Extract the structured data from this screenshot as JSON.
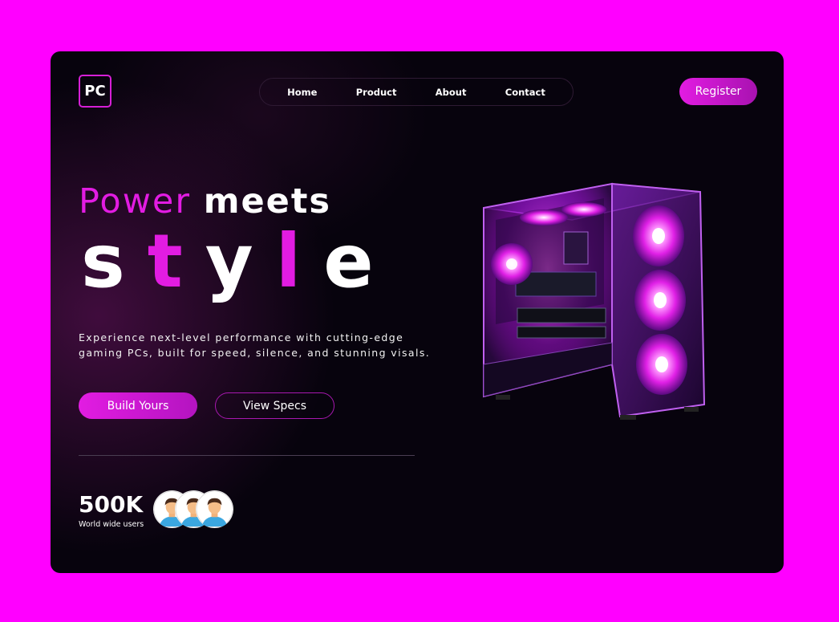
{
  "brand": {
    "logo_text": "PC"
  },
  "nav": {
    "items": [
      {
        "label": "Home"
      },
      {
        "label": "Product"
      },
      {
        "label": "About"
      },
      {
        "label": "Contact"
      }
    ]
  },
  "header": {
    "register_label": "Register"
  },
  "hero": {
    "headline_part1": "Power",
    "headline_part2": "meets",
    "headline_word_letters": [
      "s",
      "t",
      "y",
      "l",
      "e"
    ],
    "description": "Experience next-level performance with cutting-edge gaming PCs, built for speed, silence, and stunning visals.",
    "primary_button": "Build Yours",
    "secondary_button": "View Specs"
  },
  "stats": {
    "value": "500K",
    "label": "World wide users"
  },
  "colors": {
    "page_background": "#ff00ff",
    "card_background": "#07030d",
    "accent": "#e21ce2",
    "text": "#ffffff"
  },
  "icons": {
    "avatars": [
      "user-avatar-icon",
      "user-avatar-icon",
      "user-avatar-icon"
    ],
    "product": "gaming-pc-case-image"
  }
}
